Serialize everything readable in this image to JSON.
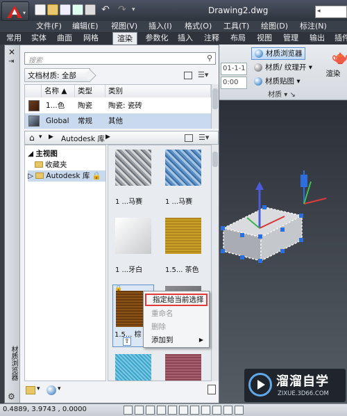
{
  "title_bar": {
    "document": "Drawing2.dwg",
    "search_arrow": "◂"
  },
  "menubar": [
    "文件(F)",
    "编辑(E)",
    "视图(V)",
    "插入(I)",
    "格式(O)",
    "工具(T)",
    "绘图(D)",
    "标注(N)"
  ],
  "ribbon_tabs": [
    "常用",
    "实体",
    "曲面",
    "网格",
    "渲染",
    "参数化",
    "插入",
    "注释",
    "布局",
    "视图",
    "管理",
    "输出",
    "插件"
  ],
  "ribbon": {
    "date1": "01-1-1",
    "date2": "0:00",
    "material_browser": "材质浏览器",
    "material_texture": "材质/ 纹理开",
    "material_mapping": "材质贴图",
    "group_label": "材质",
    "render": "渲染"
  },
  "browser": {
    "panel_title": "材质浏览器",
    "search_placeholder": "搜索",
    "doc_materials": "文档材质: 全部",
    "columns": [
      "名称",
      "类型",
      "类别"
    ],
    "rows": [
      {
        "name": "1...色",
        "type": "陶瓷",
        "category": "陶瓷: 瓷砖"
      },
      {
        "name": "Global",
        "type": "常规",
        "category": "其他"
      }
    ],
    "library_crumb": "Autodesk 库",
    "tree": {
      "root": "主视图",
      "favorites": "收藏夹",
      "library": "Autodesk 库"
    },
    "tiles": [
      "1 ...马赛",
      "1 ...马赛",
      "1 ...牙白",
      "1.5... 茶色",
      "1.5... 棕",
      "",
      "",
      ""
    ]
  },
  "context_menu": [
    "指定给当前选择",
    "重命名",
    "删除",
    "添加到"
  ],
  "status": {
    "coords": "0.4889,  3.9743 , 0.0000"
  },
  "watermark": {
    "name": "溜溜自学",
    "url": "ZIXUE.3D66.COM"
  }
}
